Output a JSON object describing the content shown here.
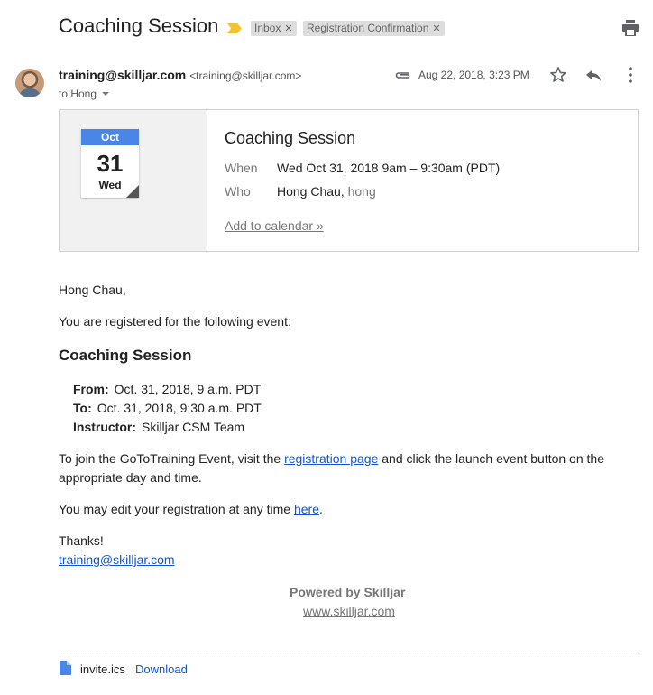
{
  "header": {
    "subject": "Coaching Session",
    "labels": [
      "Inbox",
      "Registration Confirmation"
    ]
  },
  "sender": {
    "name": "training@skilljar.com",
    "email": "<training@skilljar.com>",
    "to": "to Hong",
    "date": "Aug 22, 2018, 3:23 PM"
  },
  "invite": {
    "month": "Oct",
    "day": "31",
    "weekday": "Wed",
    "title": "Coaching Session",
    "when_label": "When",
    "when_value": "Wed Oct 31, 2018 9am – 9:30am (PDT)",
    "who_label": "Who",
    "who_name": "Hong Chau,",
    "who_user": "hong",
    "add_to_calendar": "Add to calendar »"
  },
  "body": {
    "greeting": "Hong Chau,",
    "intro": "You are registered for the following event:",
    "event_title": "Coaching Session",
    "from_label": "From:",
    "from_value": "Oct. 31, 2018, 9 a.m. PDT",
    "to_label": "To:",
    "to_value": "Oct. 31, 2018, 9:30 a.m. PDT",
    "instructor_label": "Instructor:",
    "instructor_value": "Skilljar CSM Team",
    "join_pre": "To join the GoToTraining Event, visit the ",
    "join_link": "registration page",
    "join_post": " and click the launch event button on the",
    "join_line2": "appropriate day and time.",
    "edit_pre": "You may edit your registration at any time ",
    "edit_link": "here",
    "edit_post": ".",
    "thanks": "Thanks!",
    "signature_email": "training@skilljar.com",
    "powered_by": "Powered by Skilljar",
    "website": "www.skilljar.com"
  },
  "attachment": {
    "filename": "invite.ics",
    "download_label": "Download"
  },
  "colors": {
    "accent": "#4a86e8",
    "link": "#1155cc",
    "important_marker": "#f2c230"
  },
  "icons": [
    "importance-marker-icon",
    "print-icon",
    "paperclip-icon",
    "star-icon",
    "reply-icon",
    "more-vert-icon",
    "file-icon",
    "close-icon"
  ]
}
